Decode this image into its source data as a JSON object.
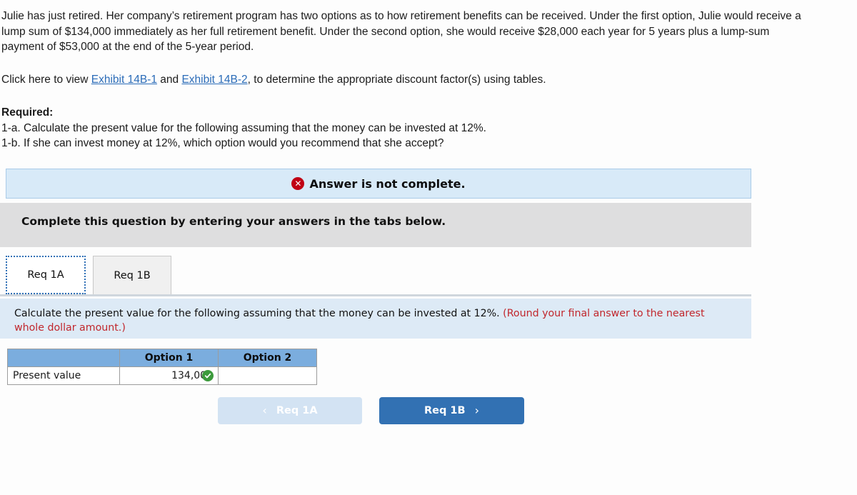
{
  "problem": {
    "statement": "Julie has just retired. Her company’s retirement program has two options as to how retirement benefits can be received. Under the first option, Julie would receive a lump sum of $134,000 immediately as her full retirement benefit. Under the second option, she would receive $28,000 each year for 5 years plus a lump-sum payment of $53,000 at the end of the 5-year period.",
    "click_prefix": "Click here to view ",
    "link_1": "Exhibit 14B-1",
    "click_middle": " and ",
    "link_2": "Exhibit 14B-2",
    "click_suffix": ", to determine the appropriate discount factor(s) using tables.",
    "required_title": "Required:",
    "requirement_a": "1-a. Calculate the present value for the following assuming that the money can be invested at 12%.",
    "requirement_b": "1-b. If she can invest money at 12%, which option would you recommend that she accept?"
  },
  "alert": {
    "icon": "error-circle-x-icon",
    "text": "Answer is not complete.",
    "icon_glyph": "✕",
    "bg_color": "#d8eaf8",
    "icon_color": "#c00014"
  },
  "gray_banner": {
    "text": "Complete this question by entering your answers in the tabs below.",
    "bg_color": "#dededf"
  },
  "tabs": [
    {
      "label": "Req 1A",
      "active": true
    },
    {
      "label": "Req 1B",
      "active": false
    }
  ],
  "instruction": {
    "main": "Calculate the present value for the following assuming that the money can be invested at 12%. ",
    "note": "(Round your final answer to the nearest whole dollar amount.)",
    "note_color": "#c1272d",
    "bg_color": "#ddeaf6"
  },
  "answer_table": {
    "header_bg": "#7badde",
    "columns": [
      "",
      "Option 1",
      "Option 2"
    ],
    "rows": [
      {
        "label": "Present value",
        "option_1": "134,000",
        "option_1_status": "correct-check-icon",
        "option_2": ""
      }
    ]
  },
  "navigation": {
    "prev_label": "Req 1A",
    "prev_chevron": "‹",
    "prev_disabled": true,
    "next_label": "Req 1B",
    "next_chevron": "›",
    "next_color": "#3271b3"
  }
}
